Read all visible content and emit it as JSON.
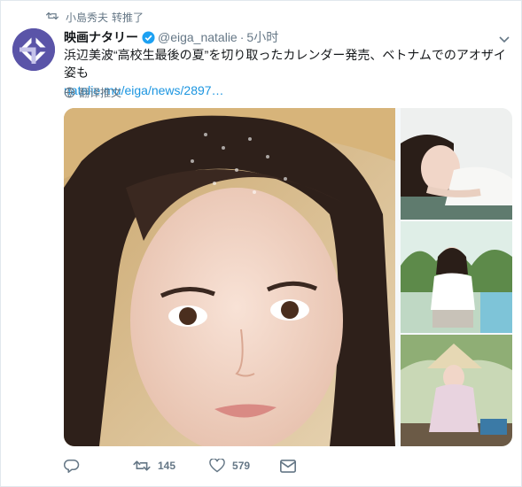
{
  "retweet": {
    "by": "小島秀夫",
    "action": "转推了"
  },
  "tweet": {
    "author_name": "映画ナタリー",
    "handle": "@eiga_natalie",
    "separator": "·",
    "time": "5小时",
    "text": "浜辺美波“高校生最後の夏”を切り取ったカレンダー発売、ベトナムでのアオザイ姿も",
    "link": "natalie.mu/eiga/news/2897…",
    "translate_label": "翻译推文"
  },
  "stats": {
    "retweets": "145",
    "likes": "579"
  },
  "colors": {
    "accent": "#1b95e0",
    "muted": "#657786",
    "avatar": "#5a54a8"
  }
}
